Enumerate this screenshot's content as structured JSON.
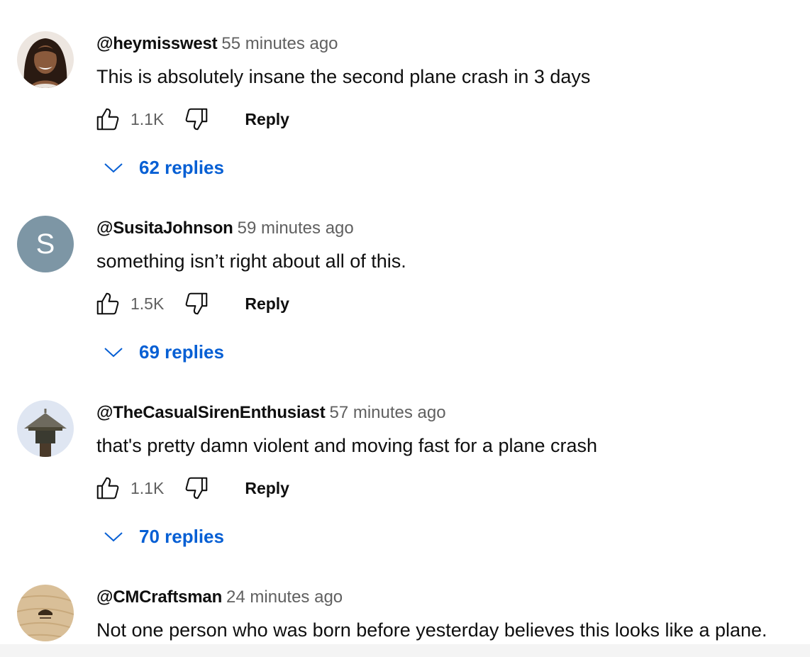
{
  "comments": [
    {
      "author": "@heymisswest",
      "time": "55 minutes ago",
      "text": "This is absolutely insane the second plane crash in 3 days",
      "likes": "1.1K",
      "reply_label": "Reply",
      "replies_label": "62 replies",
      "avatar_icon": "woman-portrait-avatar"
    },
    {
      "author": "@SusitaJohnson",
      "time": "59 minutes ago",
      "text": "something isn’t right about all of this.",
      "likes": "1.5K",
      "reply_label": "Reply",
      "replies_label": "69 replies",
      "avatar_letter": "S",
      "avatar_color": "#7d96a5"
    },
    {
      "author": "@TheCasualSirenEnthusiast",
      "time": "57 minutes ago",
      "text": "that's pretty damn violent and moving fast for a plane crash",
      "likes": "1.1K",
      "reply_label": "Reply",
      "replies_label": "70 replies",
      "avatar_icon": "siren-avatar"
    },
    {
      "author": "@CMCraftsman",
      "time": "24 minutes ago",
      "text": "Not one person who was born before yesterday believes this looks like a plane.",
      "avatar_icon": "wood-logo-avatar"
    }
  ],
  "icons": {
    "like": "thumbs-up-icon",
    "dislike": "thumbs-down-icon",
    "expand": "chevron-down-icon"
  },
  "colors": {
    "link_blue": "#065fd4",
    "meta_gray": "#606060",
    "text": "#0f0f0f"
  }
}
